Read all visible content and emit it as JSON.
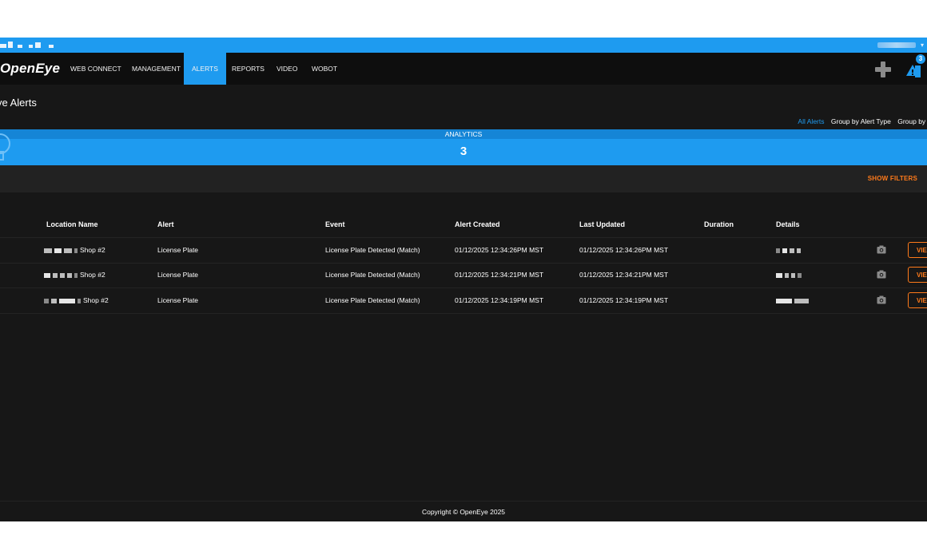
{
  "header": {
    "logo": "OpenEye",
    "nav": [
      {
        "label": "WEB CONNECT"
      },
      {
        "label": "MANAGEMENT"
      },
      {
        "label": "ALERTS",
        "active": true
      },
      {
        "label": "REPORTS"
      },
      {
        "label": "VIDEO"
      },
      {
        "label": "WOBOT"
      }
    ],
    "alert_badge": "3"
  },
  "page": {
    "title": "ye Alerts",
    "group_links": [
      "All Alerts",
      "Group by Alert Type",
      "Group by Lo"
    ]
  },
  "analytics": {
    "label": "ANALYTICS",
    "count": "3"
  },
  "filters": {
    "show_filters": "SHOW FILTERS"
  },
  "table": {
    "columns": [
      "Location Name",
      "Alert",
      "Event",
      "Alert Created",
      "Last Updated",
      "Duration",
      "Details"
    ],
    "rows": [
      {
        "location_suffix": "Shop #2",
        "alert": "License Plate",
        "event": "License Plate Detected (Match)",
        "created": "01/12/2025 12:34:26PM MST",
        "updated": "01/12/2025 12:34:26PM MST",
        "duration": "",
        "action": "VIE"
      },
      {
        "location_suffix": "Shop #2",
        "alert": "License Plate",
        "event": "License Plate Detected (Match)",
        "created": "01/12/2025 12:34:21PM MST",
        "updated": "01/12/2025 12:34:21PM MST",
        "duration": "",
        "action": "VIE"
      },
      {
        "location_suffix": "Shop #2",
        "alert": "License Plate",
        "event": "License Plate Detected (Match)",
        "created": "01/12/2025 12:34:19PM MST",
        "updated": "01/12/2025 12:34:19PM MST",
        "duration": "",
        "action": "VIE"
      }
    ]
  },
  "footer": {
    "copyright": "Copyright © OpenEye 2025"
  },
  "colors": {
    "accent": "#1e9bf0",
    "action_orange": "#ff7a1a",
    "background": "#171717"
  }
}
